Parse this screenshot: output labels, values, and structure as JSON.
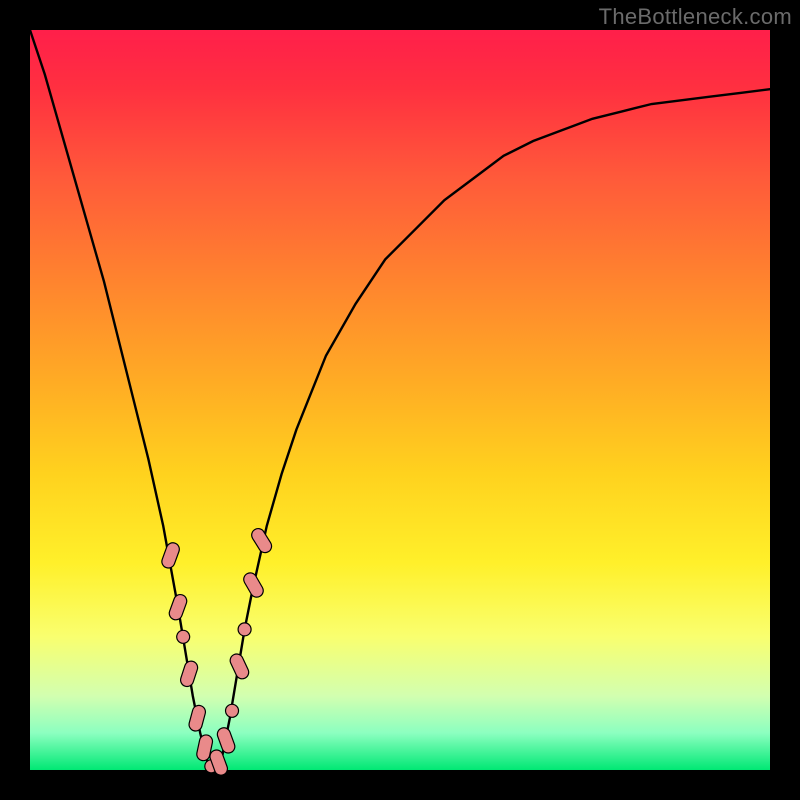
{
  "watermark": "TheBottleneck.com",
  "colors": {
    "curve_stroke": "#000000",
    "marker_fill": "#e98a8a",
    "marker_stroke": "#000000"
  },
  "chart_data": {
    "type": "line",
    "title": "",
    "xlabel": "",
    "ylabel": "",
    "xlim": [
      0,
      100
    ],
    "ylim": [
      0,
      100
    ],
    "x": [
      0,
      2,
      4,
      6,
      8,
      10,
      12,
      14,
      16,
      18,
      20,
      21,
      22,
      23,
      24,
      25,
      26,
      27,
      28,
      29,
      30,
      32,
      34,
      36,
      38,
      40,
      44,
      48,
      52,
      56,
      60,
      64,
      68,
      72,
      76,
      80,
      84,
      88,
      92,
      96,
      100
    ],
    "values": [
      100,
      94,
      87,
      80,
      73,
      66,
      58,
      50,
      42,
      33,
      22,
      16,
      10,
      5,
      1,
      0,
      2,
      7,
      13,
      19,
      24,
      33,
      40,
      46,
      51,
      56,
      63,
      69,
      73,
      77,
      80,
      83,
      85,
      86.5,
      88,
      89,
      90,
      90.5,
      91,
      91.5,
      92
    ],
    "markers": [
      {
        "x": 19.0,
        "y": 29,
        "shape": "capsule",
        "angle": -70
      },
      {
        "x": 20.0,
        "y": 22,
        "shape": "capsule",
        "angle": -70
      },
      {
        "x": 20.7,
        "y": 18,
        "shape": "dot"
      },
      {
        "x": 21.5,
        "y": 13,
        "shape": "capsule",
        "angle": -72
      },
      {
        "x": 22.6,
        "y": 7,
        "shape": "capsule",
        "angle": -75
      },
      {
        "x": 23.6,
        "y": 3,
        "shape": "capsule",
        "angle": -78
      },
      {
        "x": 24.5,
        "y": 0.5,
        "shape": "dot"
      },
      {
        "x": 25.5,
        "y": 1,
        "shape": "capsule",
        "angle": 70
      },
      {
        "x": 26.5,
        "y": 4,
        "shape": "capsule",
        "angle": 70
      },
      {
        "x": 27.3,
        "y": 8,
        "shape": "dot"
      },
      {
        "x": 28.3,
        "y": 14,
        "shape": "capsule",
        "angle": 65
      },
      {
        "x": 29.0,
        "y": 19,
        "shape": "dot"
      },
      {
        "x": 30.2,
        "y": 25,
        "shape": "capsule",
        "angle": 60
      },
      {
        "x": 31.3,
        "y": 31,
        "shape": "capsule",
        "angle": 58
      }
    ]
  }
}
